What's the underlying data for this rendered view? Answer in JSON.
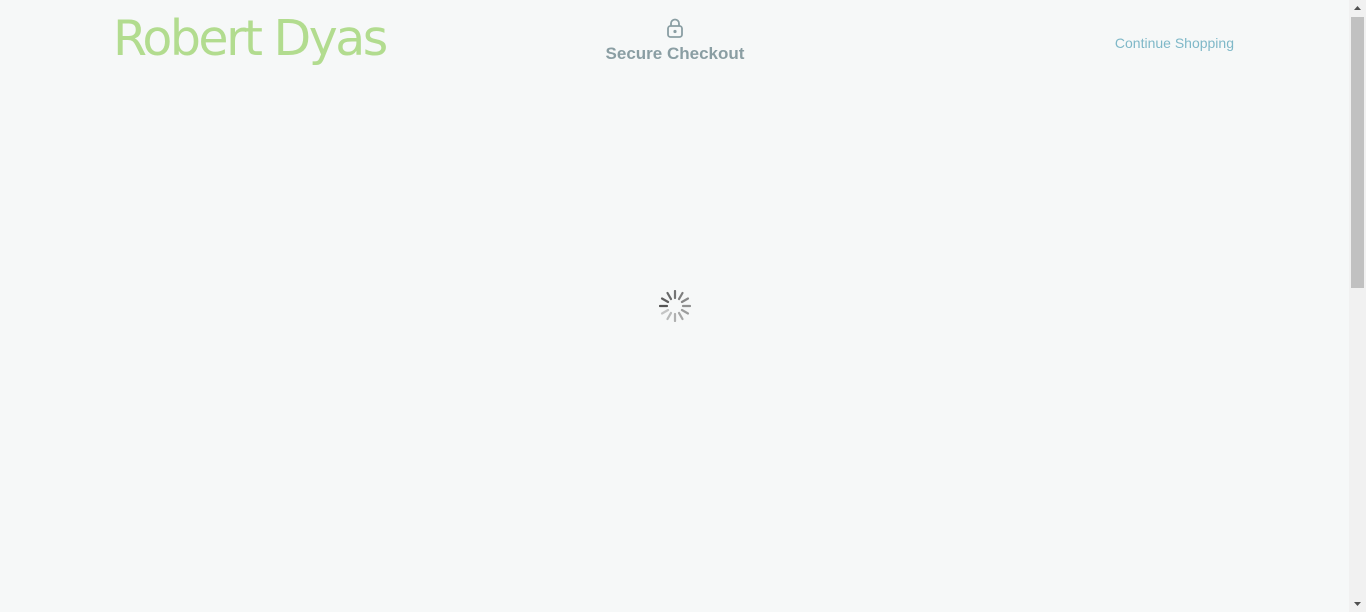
{
  "header": {
    "logo_text": "Robert Dyas",
    "secure_title": "Secure Checkout",
    "lock_icon": "lock-icon",
    "continue_link": "Continue Shopping"
  },
  "loading": {
    "icon": "spinner-icon"
  },
  "colors": {
    "background": "#f6f8f8",
    "logo": "#b2dc8f",
    "secure_title": "#8a9ea3",
    "continue_link": "#7fb8c8",
    "spinner": "#555555"
  },
  "scrollbar": {
    "position": 0
  }
}
